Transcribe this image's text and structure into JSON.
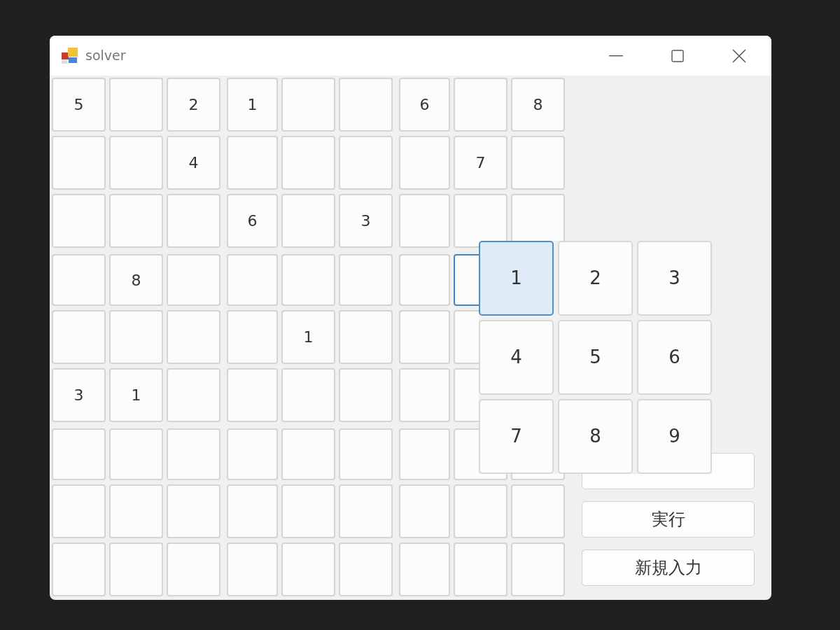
{
  "window": {
    "title": "solver"
  },
  "grid": {
    "rows": [
      [
        {
          "value": "5",
          "selected": false
        },
        {
          "selected": false
        },
        {
          "value": "2",
          "selected": false
        },
        {
          "value": "1",
          "selected": false
        },
        {
          "selected": false
        },
        {
          "selected": false
        },
        {
          "value": "6",
          "selected": false
        },
        {
          "selected": false
        },
        {
          "value": "8",
          "selected": false
        }
      ],
      [
        {
          "selected": false
        },
        {
          "selected": false
        },
        {
          "value": "4",
          "selected": false
        },
        {
          "selected": false
        },
        {
          "selected": false
        },
        {
          "selected": false
        },
        {
          "selected": false
        },
        {
          "value": "7",
          "selected": false
        },
        {
          "selected": false
        }
      ],
      [
        {
          "selected": false
        },
        {
          "selected": false
        },
        {
          "selected": false
        },
        {
          "value": "6",
          "selected": false
        },
        {
          "selected": false
        },
        {
          "value": "3",
          "selected": false
        },
        {
          "selected": false
        },
        {
          "selected": false
        },
        {
          "selected": false
        }
      ],
      [
        {
          "selected": false
        },
        {
          "value": "8",
          "selected": false
        },
        {
          "selected": false
        },
        {
          "selected": false
        },
        {
          "selected": false
        },
        {
          "selected": false
        },
        {
          "selected": false
        },
        {
          "selected": true
        }
      ],
      [
        {
          "selected": false
        },
        {
          "selected": false
        },
        {
          "selected": false
        },
        {
          "selected": false
        },
        {
          "value": "1",
          "selected": false
        },
        {
          "selected": false
        },
        {
          "selected": false
        },
        {
          "selected": false
        }
      ],
      [
        {
          "value": "3",
          "selected": false
        },
        {
          "value": "1",
          "selected": false
        },
        {
          "selected": false
        },
        {
          "selected": false
        },
        {
          "selected": false
        },
        {
          "selected": false
        },
        {
          "selected": false
        },
        {
          "selected": false
        }
      ],
      [
        {
          "selected": false
        },
        {
          "selected": false
        },
        {
          "selected": false
        },
        {
          "selected": false
        },
        {
          "selected": false
        },
        {
          "selected": false
        },
        {
          "selected": false
        },
        {
          "selected": false
        },
        {
          "selected": false
        }
      ],
      [
        {
          "selected": false
        },
        {
          "selected": false
        },
        {
          "selected": false
        },
        {
          "selected": false
        },
        {
          "selected": false
        },
        {
          "selected": false
        },
        {
          "selected": false
        },
        {
          "selected": false
        },
        {
          "selected": false
        }
      ],
      [
        {
          "selected": false
        },
        {
          "selected": false
        },
        {
          "selected": false
        },
        {
          "selected": false
        },
        {
          "selected": false
        },
        {
          "selected": false
        },
        {
          "selected": false
        },
        {
          "selected": false
        },
        {
          "selected": false
        }
      ]
    ]
  },
  "actions": [
    {
      "label": "実行"
    },
    {
      "label": "新規入力"
    }
  ],
  "keypad": {
    "keys": [
      {
        "label": "1",
        "selected": true
      },
      {
        "label": "2",
        "selected": false
      },
      {
        "label": "3",
        "selected": false
      },
      {
        "label": "4",
        "selected": false
      },
      {
        "label": "5",
        "selected": false
      },
      {
        "label": "6",
        "selected": false
      },
      {
        "label": "7",
        "selected": false
      },
      {
        "label": "8",
        "selected": false
      },
      {
        "label": "9",
        "selected": false
      }
    ]
  }
}
